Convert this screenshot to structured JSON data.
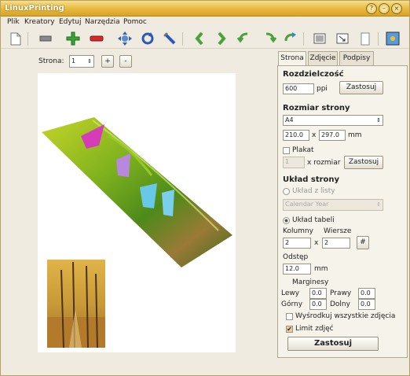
{
  "window": {
    "title": "LinuxPrinting",
    "btn_help": "?",
    "btn_min": "–",
    "btn_max": "□",
    "btn_close": "×"
  },
  "menu": {
    "plik": "Plik",
    "kreatory": "Kreatory",
    "edytuj": "Edytuj",
    "narzedzia": "Narzędzia",
    "pomoc": "Pomoc"
  },
  "page_nav": {
    "label": "Strona:",
    "value": "1",
    "plus": "+",
    "minus": "-"
  },
  "tabs": {
    "strona": "Strona",
    "zdjecie": "Zdjęcie",
    "podpisy": "Podpisy"
  },
  "resolution": {
    "title": "Rozdzielczość",
    "value": "600",
    "unit": "ppi",
    "apply": "Zastosuj"
  },
  "page_size": {
    "title": "Rozmiar strony",
    "format": "A4",
    "width": "210.0",
    "x": "x",
    "height": "297.0",
    "unit": "mm"
  },
  "poster": {
    "label": "Plakat",
    "value": "1",
    "x_size": "x rozmiar",
    "apply": "Zastosuj"
  },
  "layout": {
    "title": "Układ strony",
    "from_list": "Układ z listy",
    "list_value": "Calendar Year",
    "table": "Układ tabeli",
    "columns_label": "Kolumny",
    "rows_label": "Wiersze",
    "columns": "2",
    "x": "x",
    "rows": "2",
    "hash": "#",
    "spacing_label": "Odstęp",
    "spacing": "12.0",
    "spacing_unit": "mm"
  },
  "margins": {
    "title": "Marginesy",
    "left_label": "Lewy",
    "left": "0.0",
    "right_label": "Prawy",
    "right": "0.0",
    "top_label": "Górny",
    "top": "0.0",
    "bottom_label": "Dolny",
    "bottom": "0.0"
  },
  "options": {
    "center": "Wyśrodkuj wszystkie zdjęcia",
    "limit": "Limit zdjęć",
    "check": "✔"
  },
  "apply_all": "Zastosuj",
  "colors": {
    "title_bar": "#e8b83c",
    "canvas": "#ffffff",
    "photo_green": "#7ab428",
    "photo_autumn": "#d8a030"
  }
}
